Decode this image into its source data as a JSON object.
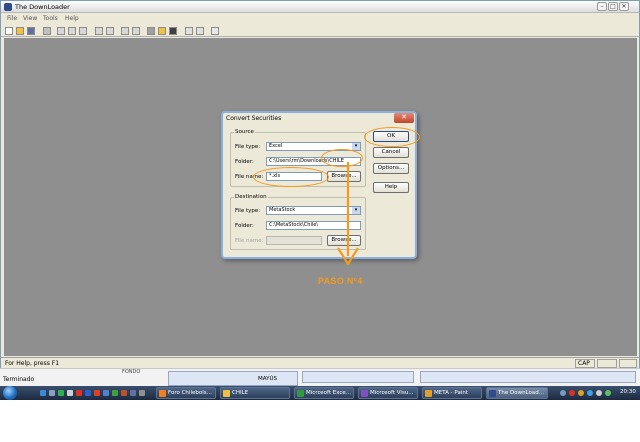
{
  "window": {
    "title": "The DownLoader",
    "min": "–",
    "max": "□",
    "close": "✕"
  },
  "menu": [
    "File",
    "View",
    "Tools",
    "Help"
  ],
  "status": {
    "message": "For Help, press F1",
    "cap": "CAP"
  },
  "behind": {
    "status_left": "Terminado",
    "panel_label": "FONDO",
    "mayus": "MAYÚS"
  },
  "taskbar": {
    "tasks": [
      "Foro Chilebols...",
      "CHILE",
      "Microsoft Exce...",
      "Microsoft Visu...",
      "META - Paint",
      "The DownLoad..."
    ],
    "clock": "20:30",
    "tray_lang": "ES"
  },
  "dialog": {
    "title": "Convert Securities",
    "close": "✕",
    "source": {
      "legend": "Source",
      "file_type_label": "File type:",
      "file_type_value": "Excel",
      "folder_label": "Folder:",
      "folder_value": "C:\\Users\\rm\\Downloads\\CHILE",
      "file_name_label": "File name:",
      "file_name_value": "*.xls",
      "browse": "Browse..."
    },
    "destination": {
      "legend": "Destination",
      "file_type_label": "File type:",
      "file_type_value": "MetaStock",
      "folder_label": "Folder:",
      "folder_value": "C:\\MetaStock\\Chile\\",
      "file_name_label": "File name:",
      "file_name_value": "",
      "browse": "Browse..."
    },
    "buttons": {
      "ok": "OK",
      "cancel": "Cancel",
      "options": "Options...",
      "help": "Help"
    }
  },
  "annotation": {
    "label": "PASO Nº4",
    "color": "#f59a1b"
  }
}
